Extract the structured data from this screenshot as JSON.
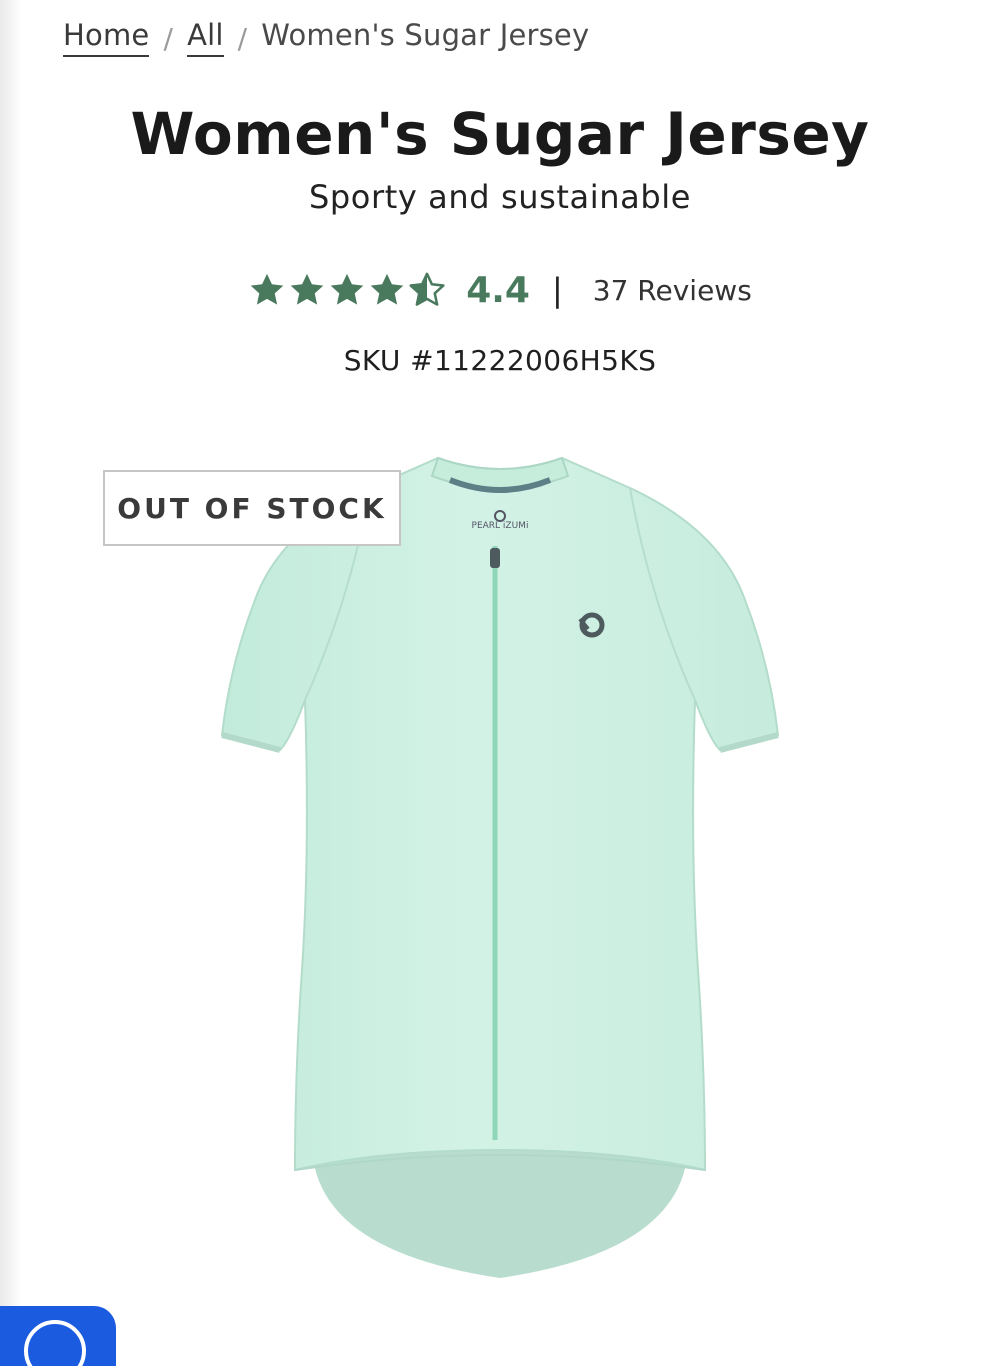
{
  "breadcrumb": {
    "home": "Home",
    "separator": "/",
    "all": "All",
    "current": "Women's Sugar Jersey"
  },
  "product": {
    "title": "Women's Sugar Jersey",
    "subtitle": "Sporty and sustainable",
    "rating": {
      "stars_filled": 4.5,
      "stars_total": 5,
      "value": "4.4",
      "divider": "|",
      "reviews": "37 Reviews"
    },
    "sku": "SKU #11222006H5KS",
    "stock_badge": "OUT OF STOCK",
    "image_icon": "cycling-jersey",
    "brand_logo_text": "PEARL iZUMi"
  },
  "chat_button": {
    "icon": "chat-icon"
  },
  "colors": {
    "star": "#4a7a5e",
    "rating_value": "#4a7a5e",
    "jersey": "#cdeee0",
    "chat_button": "#1a5be0",
    "badge_border": "#c6c6c6"
  }
}
